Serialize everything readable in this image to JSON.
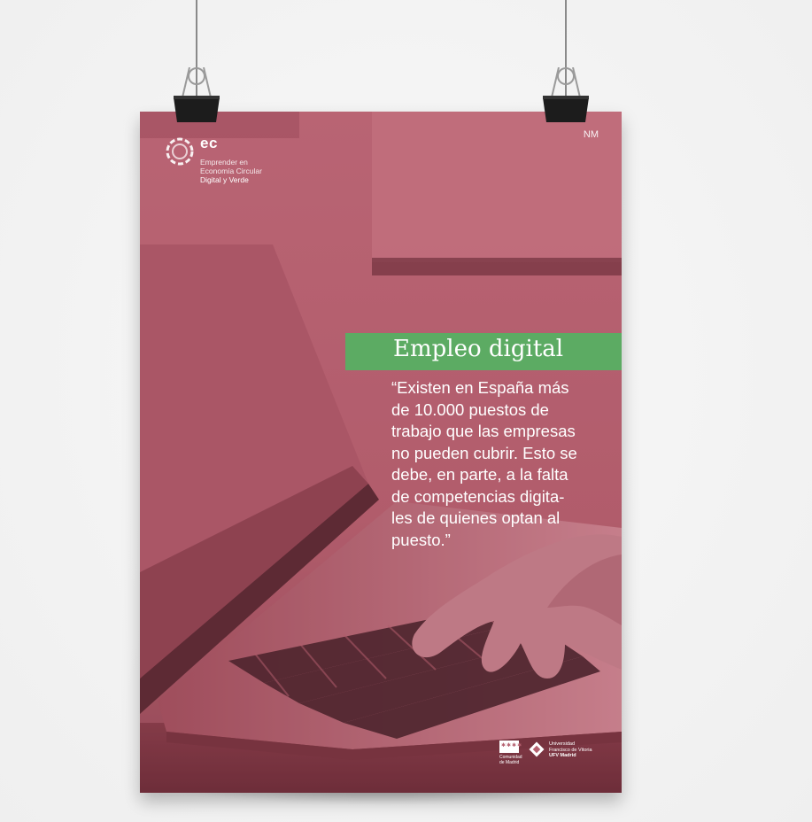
{
  "poster": {
    "corner_code": "NM",
    "logo": {
      "short": "ec",
      "line1": "Emprender en",
      "line2": "Economía Circular",
      "line3": "Digital y Verde"
    },
    "headline": "Empleo digital",
    "quote_lines": [
      "“Existen en España más",
      "de 10.000 puestos de",
      "trabajo que las empresas",
      "no pueden cubrir. Esto se",
      "debe, en parte, a la falta",
      "de competencias digita-",
      "les de quienes optan al",
      "puesto.”"
    ],
    "sponsors": {
      "left": {
        "line1": "Comunidad",
        "line2": "de Madrid"
      },
      "right": {
        "line1": "Universidad",
        "line2": "Francisco de Vitoria",
        "line3": "UFV Madrid"
      }
    }
  },
  "colors": {
    "overlay": "#b5606f",
    "band": "#5cab63",
    "text": "#ffffff",
    "wall": "#f4f4f4"
  },
  "icons": [
    "binder-clip-icon",
    "binder-clip-icon",
    "ec-circle-logo-icon",
    "comunidad-madrid-flag-icon",
    "ufv-diamond-logo-icon"
  ]
}
